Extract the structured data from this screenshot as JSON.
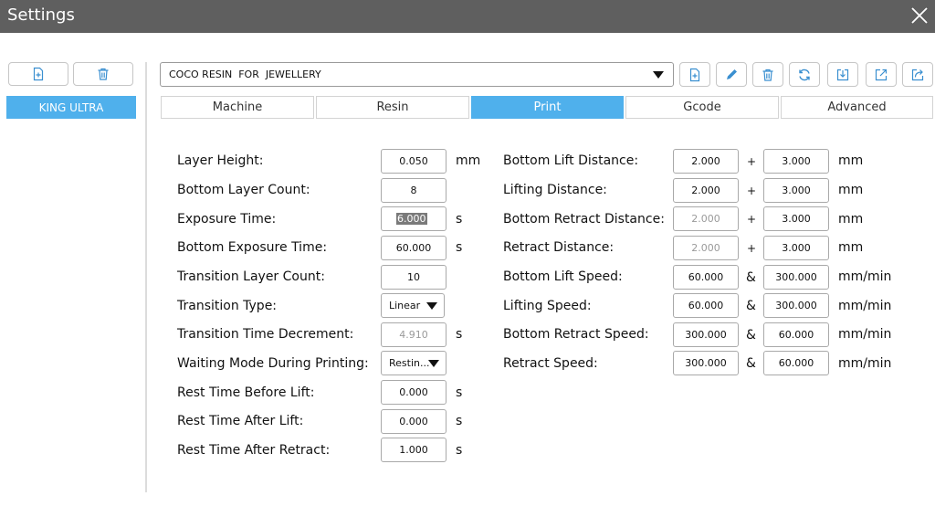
{
  "window": {
    "title": "Settings"
  },
  "machine_list": {
    "items": [
      {
        "label": "KING ULTRA"
      }
    ]
  },
  "profile": {
    "selected": "COCO RESIN  FOR  JEWELLERY"
  },
  "tabs": [
    {
      "label": "Machine"
    },
    {
      "label": "Resin"
    },
    {
      "label": "Print"
    },
    {
      "label": "Gcode"
    },
    {
      "label": "Advanced"
    }
  ],
  "left_params": [
    {
      "label": "Layer Height:",
      "value": "0.050",
      "unit": "mm"
    },
    {
      "label": "Bottom Layer Count:",
      "value": "8",
      "unit": ""
    },
    {
      "label": "Exposure Time:",
      "value": "6.000",
      "unit": "s"
    },
    {
      "label": "Bottom Exposure Time:",
      "value": "60.000",
      "unit": "s"
    },
    {
      "label": "Transition Layer Count:",
      "value": "10",
      "unit": ""
    },
    {
      "label": "Transition Type:",
      "value": "Linear",
      "unit": ""
    },
    {
      "label": "Transition Time Decrement:",
      "value": "4.910",
      "unit": "s"
    },
    {
      "label": "Waiting Mode During Printing:",
      "value": "Restin...",
      "unit": ""
    },
    {
      "label": "Rest Time Before Lift:",
      "value": "0.000",
      "unit": "s"
    },
    {
      "label": "Rest Time After Lift:",
      "value": "0.000",
      "unit": "s"
    },
    {
      "label": "Rest Time After Retract:",
      "value": "1.000",
      "unit": "s"
    }
  ],
  "right_params": [
    {
      "label": "Bottom Lift Distance:",
      "value1": "2.000",
      "op": "+",
      "value2": "3.000",
      "unit": "mm"
    },
    {
      "label": "Lifting Distance:",
      "value1": "2.000",
      "op": "+",
      "value2": "3.000",
      "unit": "mm"
    },
    {
      "label": "Bottom Retract Distance:",
      "value1": "2.000",
      "op": "+",
      "value2": "3.000",
      "unit": "mm"
    },
    {
      "label": "Retract Distance:",
      "value1": "2.000",
      "op": "+",
      "value2": "3.000",
      "unit": "mm"
    },
    {
      "label": "Bottom Lift Speed:",
      "value1": "60.000",
      "op": "&",
      "value2": "300.000",
      "unit": "mm/min"
    },
    {
      "label": "Lifting Speed:",
      "value1": "60.000",
      "op": "&",
      "value2": "300.000",
      "unit": "mm/min"
    },
    {
      "label": "Bottom Retract Speed:",
      "value1": "300.000",
      "op": "&",
      "value2": "60.000",
      "unit": "mm/min"
    },
    {
      "label": "Retract Speed:",
      "value1": "300.000",
      "op": "&",
      "value2": "60.000",
      "unit": "mm/min"
    }
  ],
  "colors": {
    "titlebar": "#5f5f5f",
    "accent": "#4fb0ec",
    "disabled_text": "#9a9a9a"
  }
}
